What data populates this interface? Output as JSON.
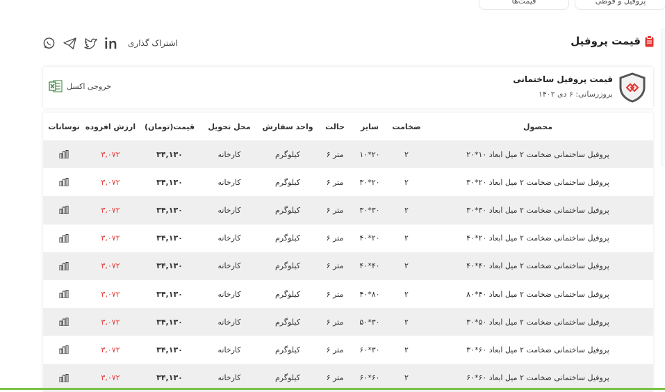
{
  "top_tabs": [
    {
      "label": "قیمت‌ها"
    },
    {
      "label": "پروفیل و قوطی"
    }
  ],
  "page": {
    "title": "قیمت پروفیل",
    "share_label": "اشتراک گذاری",
    "accent": "#e53935"
  },
  "social_icons": [
    "whatsapp-icon",
    "telegram-icon",
    "twitter-icon",
    "linkedin-icon"
  ],
  "card": {
    "title": "قیمت پروفیل ساختمانی",
    "date": "بروزرسانی: ۶ دی ۱۴۰۲",
    "excel_label": "خروجی اکسل"
  },
  "table": {
    "headers": {
      "product": "محصول",
      "thickness": "ضخامت",
      "size": "سایز",
      "state": "حالت",
      "unit": "واحد سفارش",
      "place": "محل تحویل",
      "price": "قیمت(تومان)",
      "vat": "ارزش افزوده",
      "chart": "نوسانات"
    },
    "rows": [
      {
        "product": "پروفیل ساختمانی ضخامت ۲ میل ابعاد ۱۰*۲۰",
        "thickness": "۲",
        "size": "۱۰*۲۰",
        "state": "۶ متر",
        "unit": "کیلوگرم",
        "place": "کارخانه",
        "price": "۳۴,۱۳۰",
        "vat": "۳,۰۷۲"
      },
      {
        "product": "پروفیل ساختمانی ضخامت ۲ میل ابعاد ۲۰*۳۰",
        "thickness": "۲",
        "size": "۳۰*۲۰",
        "state": "۶ متر",
        "unit": "کیلوگرم",
        "place": "کارخانه",
        "price": "۳۴,۱۳۰",
        "vat": "۳,۰۷۲"
      },
      {
        "product": "پروفیل ساختمانی ضخامت ۲ میل ابعاد ۳۰*۳۰",
        "thickness": "۲",
        "size": "۳۰*۳۰",
        "state": "۶ متر",
        "unit": "کیلوگرم",
        "place": "کارخانه",
        "price": "۳۴,۱۳۰",
        "vat": "۳,۰۷۲"
      },
      {
        "product": "پروفیل ساختمانی ضخامت ۲ میل ابعاد ۲۰*۴۰",
        "thickness": "۲",
        "size": "۴۰*۲۰",
        "state": "۶ متر",
        "unit": "کیلوگرم",
        "place": "کارخانه",
        "price": "۳۴,۱۳۰",
        "vat": "۳,۰۷۲"
      },
      {
        "product": "پروفیل ساختمانی ضخامت ۲ میل ابعاد ۴۰*۴۰",
        "thickness": "۲",
        "size": "۴۰*۴۰",
        "state": "۶ متر",
        "unit": "کیلوگرم",
        "place": "کارخانه",
        "price": "۳۴,۱۳۰",
        "vat": "۳,۰۷۲"
      },
      {
        "product": "پروفیل ساختمانی ضخامت ۲ میل ابعاد ۴۰*۸۰",
        "thickness": "۲",
        "size": "۴۰*۸۰",
        "state": "۶ متر",
        "unit": "کیلوگرم",
        "place": "کارخانه",
        "price": "۳۴,۱۳۰",
        "vat": "۳,۰۷۲"
      },
      {
        "product": "پروفیل ساختمانی ضخامت ۲ میل ابعاد ۵۰*۳۰",
        "thickness": "۲",
        "size": "۵۰*۳۰",
        "state": "۶ متر",
        "unit": "کیلوگرم",
        "place": "کارخانه",
        "price": "۳۴,۱۳۰",
        "vat": "۳,۰۷۲"
      },
      {
        "product": "پروفیل ساختمانی ضخامت ۲ میل ابعاد ۶۰*۳۰",
        "thickness": "۲",
        "size": "۶۰*۳۰",
        "state": "۶ متر",
        "unit": "کیلوگرم",
        "place": "کارخانه",
        "price": "۳۴,۱۳۰",
        "vat": "۳,۰۷۲"
      },
      {
        "product": "پروفیل ساختمانی ضخامت ۲ میل ابعاد ۶۰*۶۰",
        "thickness": "۲",
        "size": "۶۰*۶۰",
        "state": "۶ متر",
        "unit": "کیلوگرم",
        "place": "کارخانه",
        "price": "۳۴,۱۳۰",
        "vat": "۳,۰۷۲"
      }
    ]
  }
}
